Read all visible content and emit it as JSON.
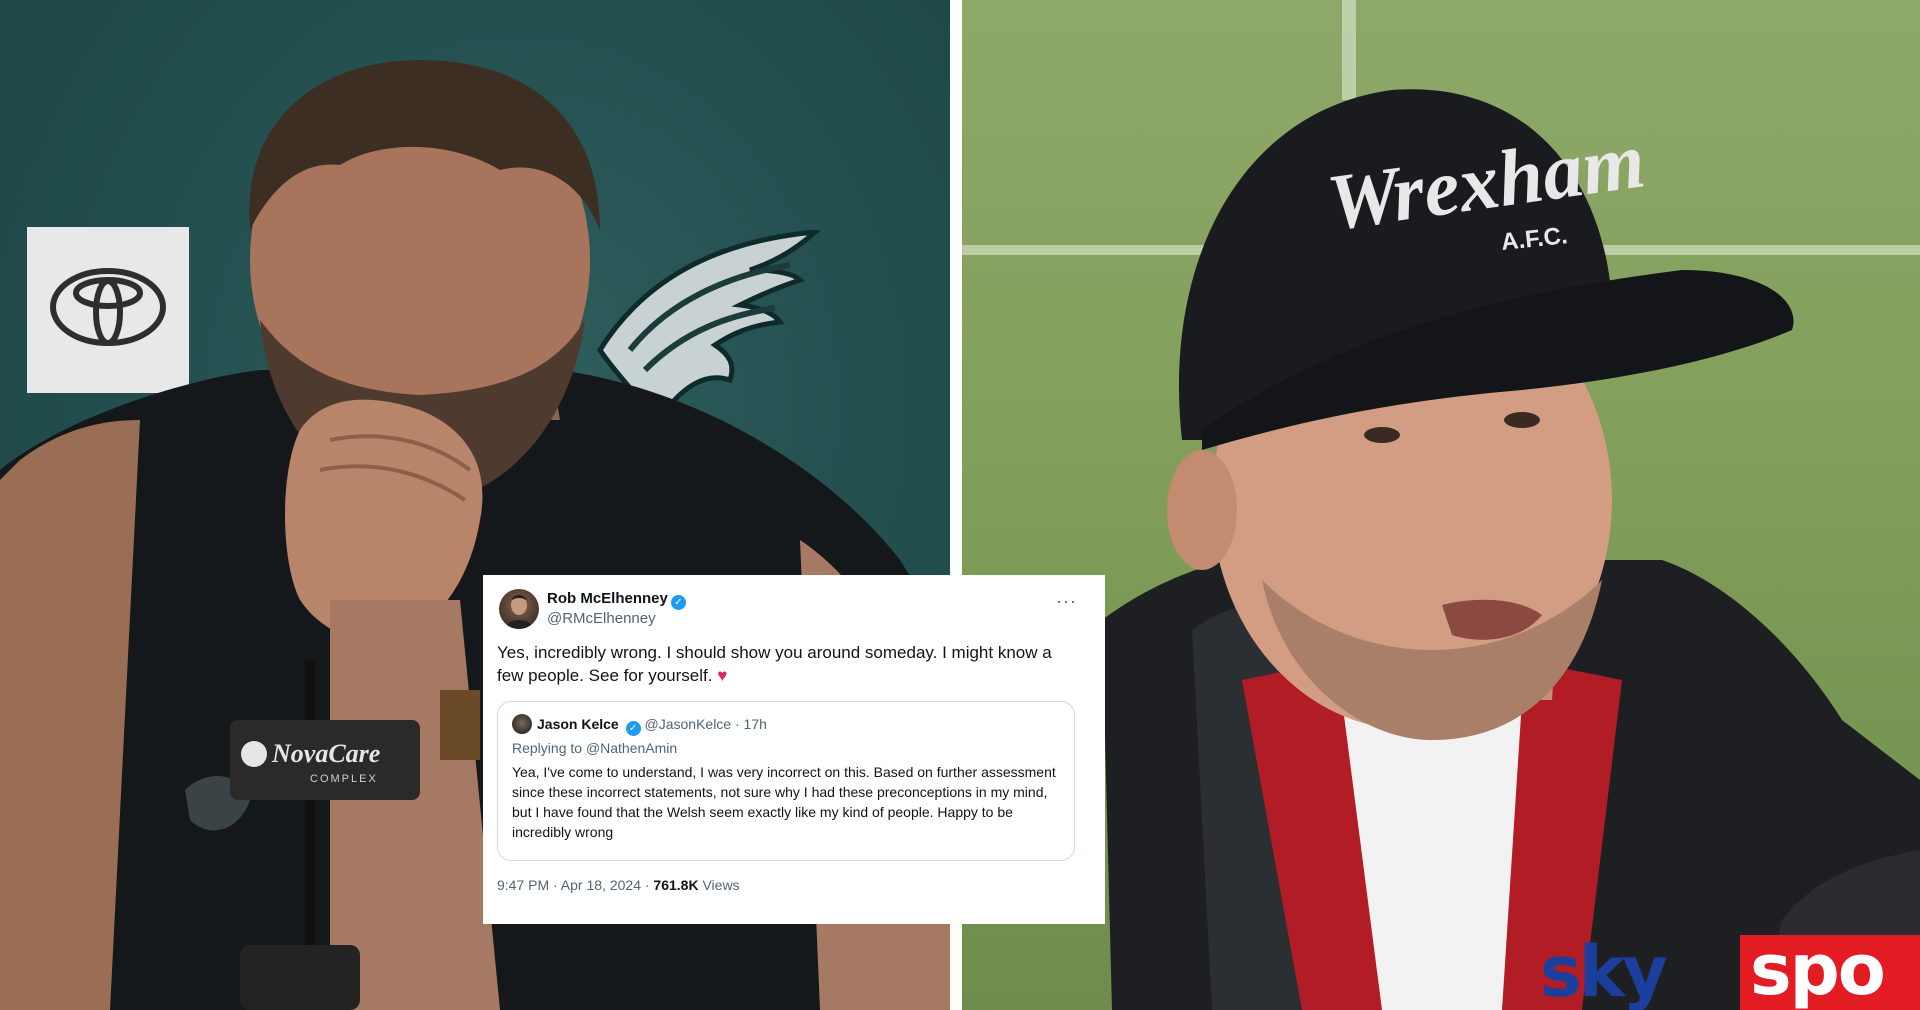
{
  "left_photo": {
    "sponsor_logo": "toyota-logo",
    "team_logo": "eagles-logo",
    "mic_sign_text": "NovaCare",
    "mic_sign_subtext": "COMPLEX"
  },
  "right_photo": {
    "cap_text": "Wrexham",
    "cap_subtext": "A.F.C.",
    "broadcaster_part1": "sky",
    "broadcaster_part2": "spo"
  },
  "tweet": {
    "author_name": "Rob McElhenney",
    "author_handle": "@RMcElhenney",
    "verified_glyph": "✓",
    "more_glyph": "···",
    "text": "Yes, incredibly wrong. I should show you around someday. I might know a few people. See for yourself.",
    "heart": "♥",
    "quoted": {
      "author_name": "Jason Kelce",
      "author_handle": "@JasonKelce",
      "time_ago": "· 17h",
      "replying_to_prefix": "Replying to ",
      "replying_to_handle": "@NathenAmin",
      "text": "Yea, I've come to understand, I was very incorrect on this. Based on further assessment since these incorrect statements, not sure why I had these preconceptions in my mind, but I have found that the Welsh seem exactly like my kind of people. Happy to be incredibly wrong"
    },
    "timestamp": "9:47 PM · Apr 18, 2024 · ",
    "views_count": "761.8K",
    "views_label": " Views"
  },
  "colors": {
    "left_bg": "#245050",
    "field_green": "#86a25f",
    "verified_blue": "#1d9bf0",
    "sky_blue": "#1c3f9e",
    "sports_red": "#e31b23"
  }
}
